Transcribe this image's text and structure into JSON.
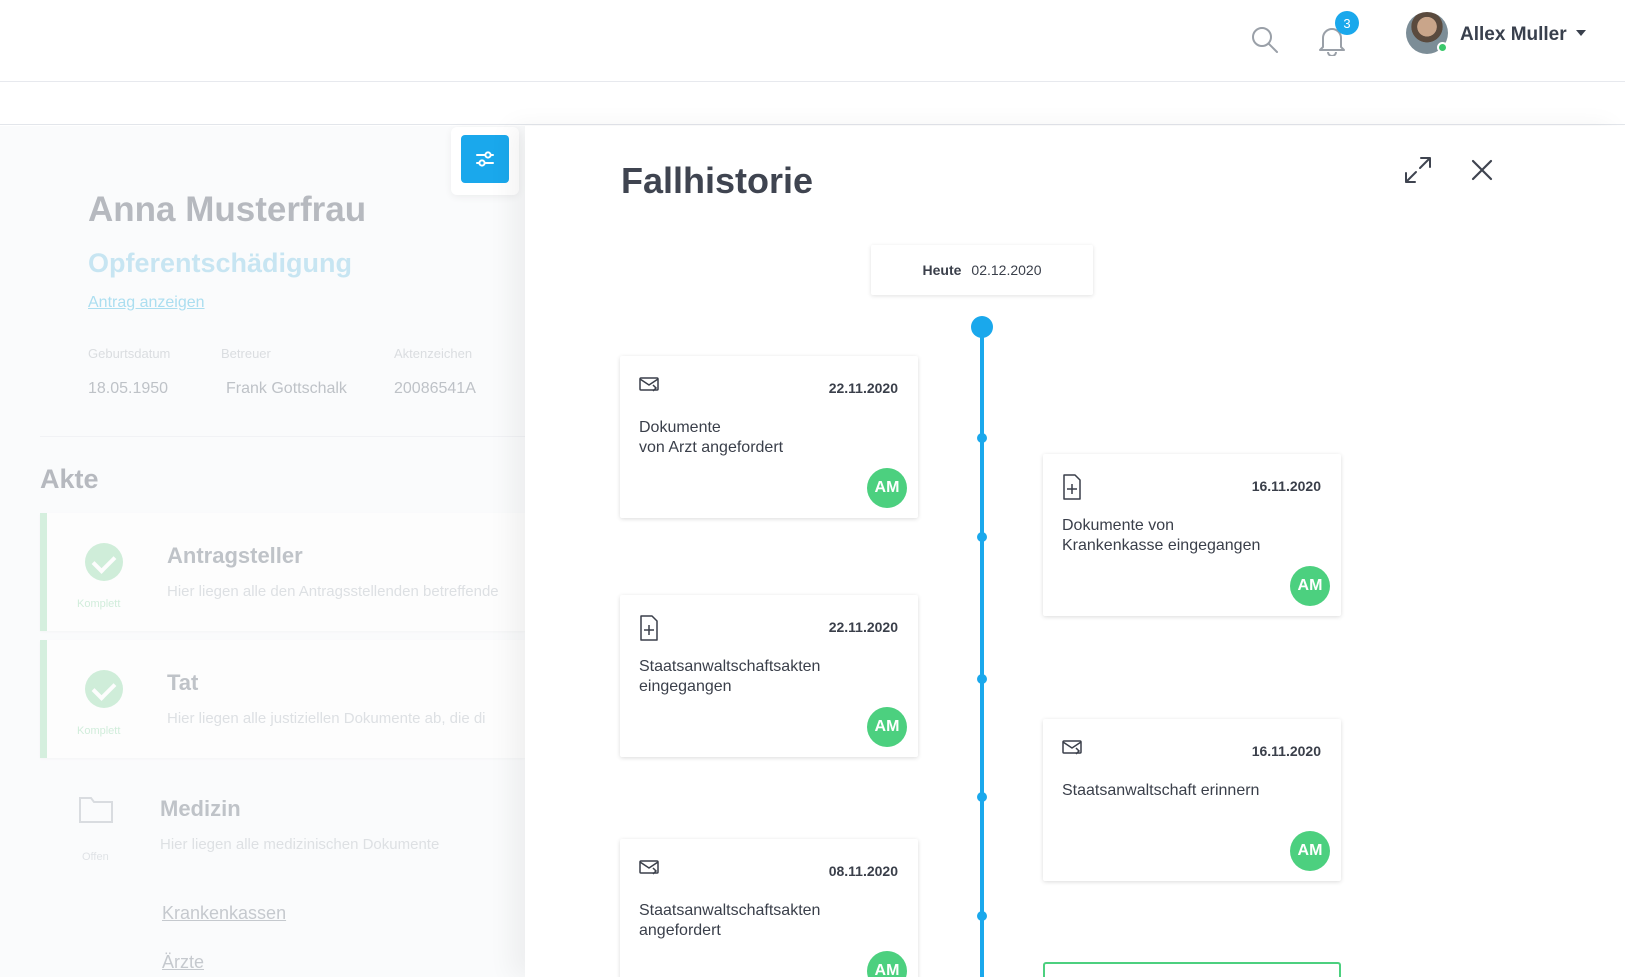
{
  "header": {
    "notification_count": "3",
    "user_name": "Allex Muller"
  },
  "case": {
    "name": "Anna Musterfrau",
    "type": "Opferentschädigung",
    "link": "Antrag anzeigen",
    "meta": [
      {
        "label": "Geburtsdatum",
        "value": "18.05.1950"
      },
      {
        "label": "Betreuer",
        "value": "Frank Gottschalk"
      },
      {
        "label": "Aktenzeichen",
        "value": "20086541A"
      }
    ]
  },
  "akte": {
    "title": "Akte",
    "sections": [
      {
        "title": "Antragsteller",
        "desc": "Hier liegen alle den Antragsstellenden betreffende",
        "state": "Komplett"
      },
      {
        "title": "Tat",
        "desc": "Hier liegen alle justiziellen Dokumente ab, die di",
        "state": "Komplett"
      },
      {
        "title": "Medizin",
        "desc": "Hier liegen alle medizinischen Dokumente",
        "state": "Offen"
      }
    ],
    "sub_links": [
      "Krankenkassen",
      "Ärzte"
    ]
  },
  "panel": {
    "title": "Fallhistorie",
    "today_label": "Heute",
    "today_date": "02.12.2020"
  },
  "events": [
    {
      "icon": "mail-forward-icon",
      "date": "22.11.2020",
      "text": "Dokumente\nvon Arzt angefordert",
      "initials": "AM"
    },
    {
      "icon": "document-add-icon",
      "date": "16.11.2020",
      "text": "Dokumente von\nKrankenkasse eingegangen",
      "initials": "AM"
    },
    {
      "icon": "document-add-icon",
      "date": "22.11.2020",
      "text": "Staatsanwaltschaftsakten\neingegangen",
      "initials": "AM"
    },
    {
      "icon": "mail-forward-icon",
      "date": "16.11.2020",
      "text": "Staatsanwaltschaft erinnern",
      "initials": "AM"
    },
    {
      "icon": "mail-forward-icon",
      "date": "08.11.2020",
      "text": "Staatsanwaltschaftsakten\nangefordert",
      "initials": "AM"
    }
  ],
  "colors": {
    "accent": "#1aa8ec",
    "avatar": "#4cd07f",
    "complete": "#b5e6c4"
  }
}
